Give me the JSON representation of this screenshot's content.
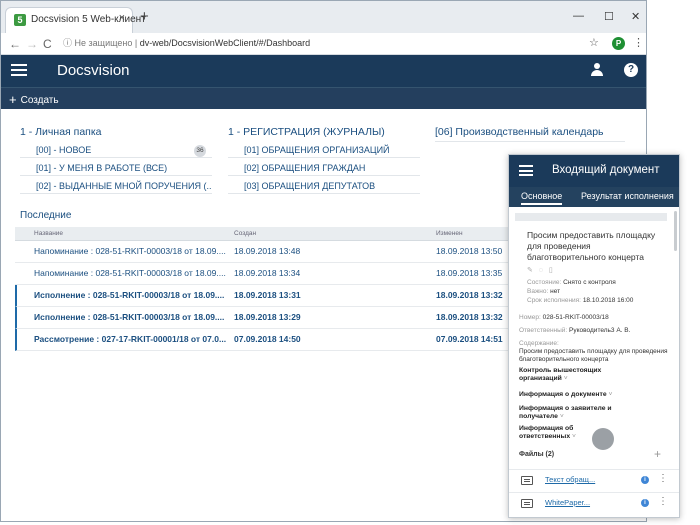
{
  "browser": {
    "tab_title": "Docsvision 5 Web-клиент",
    "tab_favicon": "5",
    "close_tab": "×",
    "new_tab": "+",
    "minimize": "—",
    "maximize": "☐",
    "close_window": "✕",
    "back": "←",
    "forward": "→",
    "reload": "C",
    "info_icon": "ⓘ",
    "security": "Не защищено",
    "separator": "|",
    "url": "dv-web/DocsvisionWebClient/#/Dashboard",
    "star": "☆",
    "profile": "P",
    "menu": "⋮"
  },
  "app": {
    "brand": "Docsvision",
    "help": "?",
    "create_icon": "+",
    "create_label": "Создать"
  },
  "sections": [
    {
      "title": "1 - Личная папка",
      "items": [
        "[00] - НОВОЕ",
        "[01] - У МЕНЯ В РАБОТЕ (ВСЕ)",
        "[02] - ВЫДАННЫЕ МНОЙ ПОРУЧЕНИЯ (..."
      ],
      "badge": "36"
    },
    {
      "title": "1 - РЕГИСТРАЦИЯ (ЖУРНАЛЫ)",
      "items": [
        "[01] ОБРАЩЕНИЯ ОРГАНИЗАЦИЙ",
        "[02] ОБРАЩЕНИЯ ГРАЖДАН",
        "[03] ОБРАЩЕНИЯ ДЕПУТАТОВ"
      ]
    },
    {
      "title": "[06] Производственный календарь"
    }
  ],
  "recent": {
    "title": "Последние",
    "columns": [
      "Название",
      "Создан",
      "Изменен"
    ],
    "rows": [
      {
        "name": "Напоминание : 028-51-RKIT-00003/18 от 18.09....",
        "created": "18.09.2018 13:48",
        "modified": "18.09.2018 13:50",
        "bold": false
      },
      {
        "name": "Напоминание : 028-51-RKIT-00003/18 от 18.09....",
        "created": "18.09.2018 13:34",
        "modified": "18.09.2018 13:35",
        "bold": false
      },
      {
        "name": "Исполнение : 028-51-RKIT-00003/18 от 18.09....",
        "created": "18.09.2018 13:31",
        "modified": "18.09.2018 13:32",
        "bold": true
      },
      {
        "name": "Исполнение : 028-51-RKIT-00003/18 от 18.09....",
        "created": "18.09.2018 13:29",
        "modified": "18.09.2018 13:32",
        "bold": true
      },
      {
        "name": "Рассмотрение : 027-17-RKIT-00001/18 от 07.0...",
        "created": "07.09.2018 14:50",
        "modified": "07.09.2018 14:51",
        "bold": true
      }
    ]
  },
  "panel": {
    "title": "Входящий документ",
    "tabs": [
      "Основное",
      "Результат исполнения"
    ],
    "doc_title": "Просим предоставить площадку для проведения благотворительного концерта",
    "doc_icons": "✎ ◌ ▯",
    "state_label": "Состояние:",
    "state_value": "Снято с контроля",
    "important_label": "Важно:",
    "important_value": "нет",
    "deadline_label": "Срок исполнения:",
    "deadline_value": "18.10.2018 16:00",
    "number_label": "Номер:",
    "number_value": "028-51-RKIT-00003/18",
    "responsible_label": "Ответственный:",
    "responsible_value": "Руководитель3 А. В.",
    "content_label": "Содержание:",
    "content_value": "Просим предоставить площадку для проведения благотворительного концерта",
    "sections": [
      "Контроль вышестоящих организаций",
      "Информация о документе",
      "Информация о заявителе и получателе",
      "Информация об ответственных"
    ],
    "caret": "˅",
    "files_label": "Файлы (2)",
    "files_add": "+",
    "files": [
      "Текст обращ...",
      "WhitePaper..."
    ],
    "file_info": "i",
    "file_more": "⋮"
  }
}
